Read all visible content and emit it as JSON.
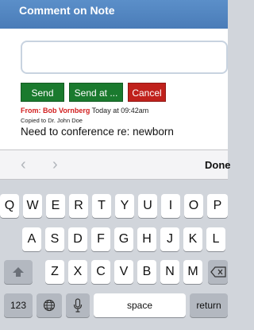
{
  "header": {
    "title": "Comment on Note"
  },
  "comment": {
    "value": "",
    "placeholder": ""
  },
  "buttons": {
    "send": "Send",
    "send_at": "Send at ...",
    "cancel": "Cancel"
  },
  "note": {
    "from": "From: Bob Vornberg",
    "time": "Today at 09:42am",
    "copied": "Copied to Dr. John Doe",
    "text": "Need to conference re: newborn"
  },
  "accessory": {
    "prev_icon": "chevron-left-icon",
    "next_icon": "chevron-right-icon",
    "done": "Done"
  },
  "keyboard": {
    "row1": [
      "Q",
      "W",
      "E",
      "R",
      "T",
      "Y",
      "U",
      "I",
      "O",
      "P"
    ],
    "row2": [
      "A",
      "S",
      "D",
      "F",
      "G",
      "H",
      "J",
      "K",
      "L"
    ],
    "row3": [
      "Z",
      "X",
      "C",
      "V",
      "B",
      "N",
      "M"
    ],
    "numbers": "123",
    "space": "space",
    "return": "return",
    "shift_icon": "shift-icon",
    "globe_icon": "globe-icon",
    "mic_icon": "microphone-icon",
    "backspace_icon": "backspace-icon"
  }
}
